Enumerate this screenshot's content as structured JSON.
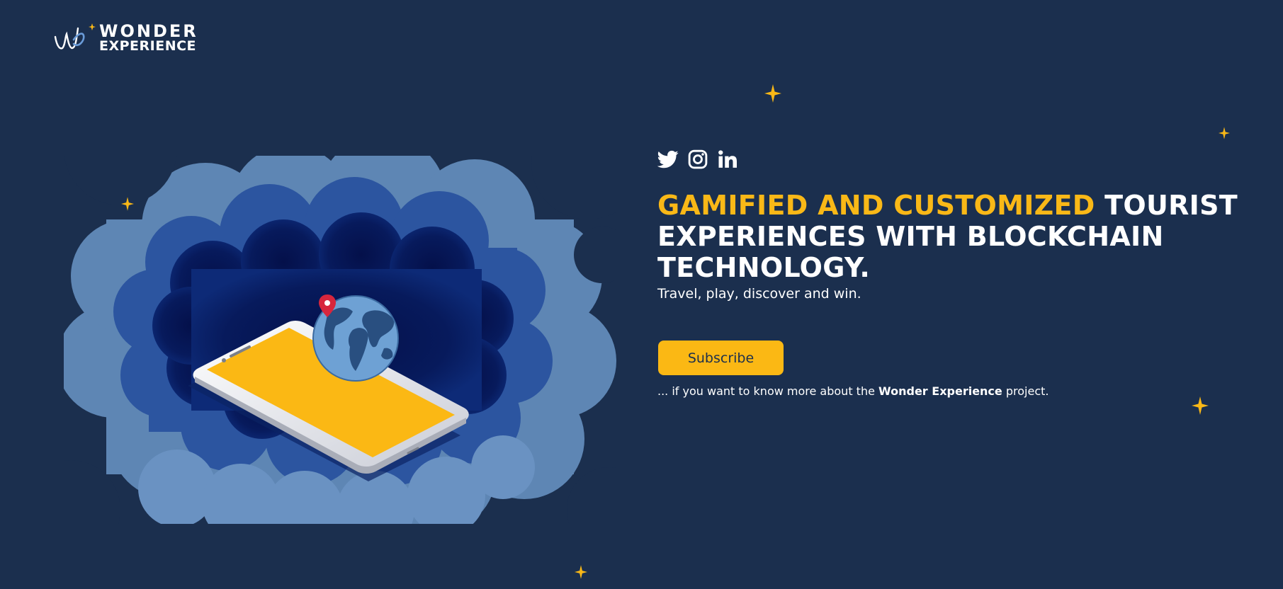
{
  "brand": {
    "line1": "WONDER",
    "line2": "EXPERIENCE",
    "logo_icon": "wonder-w-icon"
  },
  "social": [
    {
      "name": "twitter",
      "icon": "twitter-icon"
    },
    {
      "name": "instagram",
      "icon": "instagram-icon"
    },
    {
      "name": "linkedin",
      "icon": "linkedin-icon"
    }
  ],
  "hero": {
    "headline_accent": "GAMIFIED AND CUSTOMIZED",
    "headline_rest": " TOURIST EXPERIENCES WITH BLOCKCHAIN TECHNOLOGY.",
    "tagline": "Travel, play, discover and win.",
    "cta_label": "Subscribe",
    "note_prefix": "... if you want to know more about the ",
    "note_brand": "Wonder Experience",
    "note_suffix": " project."
  },
  "colors": {
    "background": "#1b2f4e",
    "accent": "#f9b817",
    "text": "#ffffff"
  }
}
